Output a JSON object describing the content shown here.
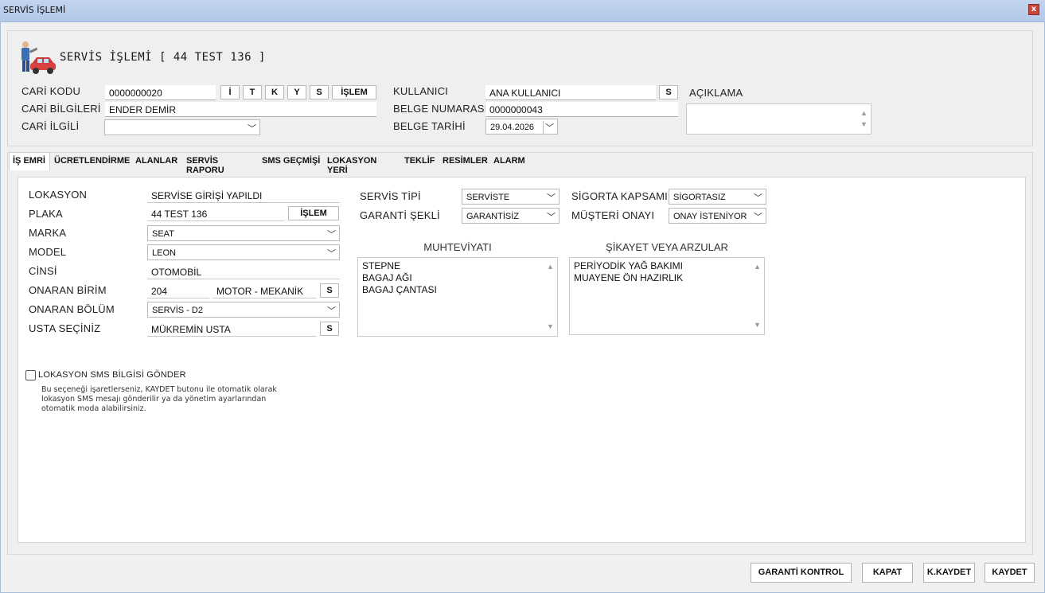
{
  "window": {
    "title": "SERVİS İŞLEMİ",
    "close": "x"
  },
  "header": {
    "title": "SERVİS İŞLEMİ [ 44 TEST 136 ]",
    "cari_kodu": {
      "label": "CARİ KODU",
      "value": "0000000020"
    },
    "cari_buttons": [
      "İ",
      "T",
      "K",
      "Y",
      "S",
      "İŞLEM"
    ],
    "cari_bilgileri": {
      "label": "CARİ BİLGİLERİ",
      "value": "ENDER DEMİR"
    },
    "cari_ilgili": {
      "label": "CARİ İLGİLİ",
      "value": ""
    },
    "kullanici": {
      "label": "KULLANICI",
      "value": "ANA KULLANICI",
      "button": "S"
    },
    "belge_numarasi": {
      "label": "BELGE NUMARASI",
      "value": "0000000043"
    },
    "belge_tarihi": {
      "label": "BELGE TARİHİ",
      "value": "29.04.2026"
    },
    "aciklama": {
      "label": "AÇIKLAMA",
      "value": ""
    }
  },
  "tabs": [
    "İŞ EMRİ",
    "ÜCRETLENDİRME",
    "ALANLAR",
    "SERVİS RAPORU",
    "SMS GEÇMİŞİ",
    "LOKASYON YERİ",
    "TEKLİF",
    "RESİMLER",
    "ALARM"
  ],
  "is_emri": {
    "lokasyon": {
      "label": "LOKASYON",
      "value": "SERVİSE GİRİŞİ YAPILDI"
    },
    "plaka": {
      "label": "PLAKA",
      "value": "44 TEST 136",
      "button": "İŞLEM"
    },
    "marka": {
      "label": "MARKA",
      "value": "SEAT"
    },
    "model": {
      "label": "MODEL",
      "value": "LEON"
    },
    "cinsi": {
      "label": "CİNSİ",
      "value": "OTOMOBİL"
    },
    "onaran_birim": {
      "label": "ONARAN BİRİM",
      "code": "204",
      "name": "MOTOR - MEKANİK",
      "button": "S"
    },
    "onaran_bolum": {
      "label": "ONARAN BÖLÜM",
      "value": "SERVİS - D2"
    },
    "usta": {
      "label": "USTA SEÇİNİZ",
      "value": "MÜKREMİN USTA",
      "button": "S"
    },
    "servis_tipi": {
      "label": "SERVİS TİPİ",
      "value": "SERVİSTE"
    },
    "garanti_sekli": {
      "label": "GARANTİ ŞEKLİ",
      "value": "GARANTİSİZ"
    },
    "sigorta_kapsami": {
      "label": "SİGORTA KAPSAMI",
      "value": "SİGORTASIZ"
    },
    "musteri_onayi": {
      "label": "MÜŞTERİ ONAYI",
      "value": "ONAY İSTENİYOR"
    },
    "muhteviyati": {
      "label": "MUHTEVİYATI",
      "lines": [
        "STEPNE",
        "BAGAJ AĞI",
        "BAGAJ ÇANTASI"
      ]
    },
    "sikayet": {
      "label": "ŞİKAYET VEYA ARZULAR",
      "lines": [
        "PERİYODİK YAĞ BAKIMI",
        "MUAYENE ÖN HAZIRLIK"
      ]
    },
    "sms_checkbox": {
      "label": "LOKASYON SMS BİLGİSİ GÖNDER",
      "checked": false
    },
    "sms_help": [
      "Bu seçeneği işaretlerseniz, KAYDET butonu ile otomatik olarak",
      "lokasyon SMS mesajı gönderilir ya da yönetim ayarlarından",
      "otomatik moda alabilirsiniz."
    ]
  },
  "footer": {
    "garanti_kontrol": "GARANTİ KONTROL",
    "kapat": "KAPAT",
    "k_kaydet": "K.KAYDET",
    "kaydet": "KAYDET"
  }
}
